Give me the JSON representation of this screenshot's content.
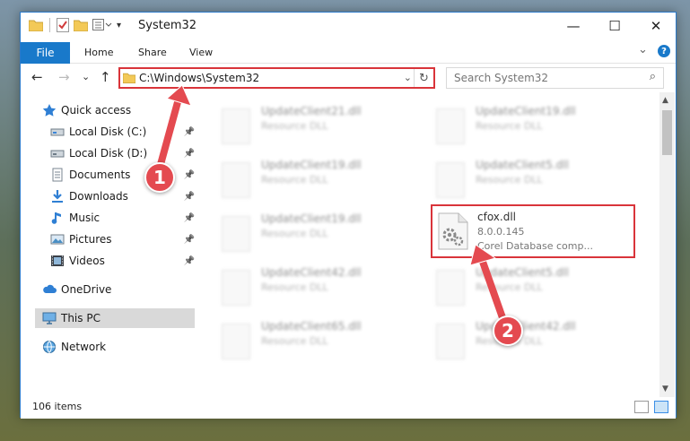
{
  "window": {
    "title": "System32",
    "minimize": "—",
    "maximize": "☐",
    "close": "✕"
  },
  "ribbon": {
    "tabs": [
      "File",
      "Home",
      "Share",
      "View"
    ],
    "expand": "⌄",
    "help": "?"
  },
  "navigation": {
    "back": "←",
    "forward": "→",
    "recent": "⌄",
    "up": "↑",
    "address": "C:\\Windows\\System32",
    "address_dropdown": "⌄",
    "refresh": "↻",
    "search_placeholder": "Search System32",
    "search_icon": "⌕"
  },
  "sidebar": {
    "items": [
      {
        "label": "Quick access",
        "icon": "star-icon",
        "pinned": false
      },
      {
        "label": "Local Disk (C:)",
        "icon": "drive-icon",
        "pinned": true
      },
      {
        "label": "Local Disk (D:)",
        "icon": "drive-icon",
        "pinned": true
      },
      {
        "label": "Documents",
        "icon": "documents-icon",
        "pinned": true
      },
      {
        "label": "Downloads",
        "icon": "downloads-icon",
        "pinned": true
      },
      {
        "label": "Music",
        "icon": "music-icon",
        "pinned": true
      },
      {
        "label": "Pictures",
        "icon": "pictures-icon",
        "pinned": true
      },
      {
        "label": "Videos",
        "icon": "videos-icon",
        "pinned": true
      },
      {
        "label": "OneDrive",
        "icon": "cloud-icon",
        "pinned": false
      },
      {
        "label": "This PC",
        "icon": "computer-icon",
        "pinned": false,
        "selected": true
      },
      {
        "label": "Network",
        "icon": "network-icon",
        "pinned": false
      }
    ],
    "pin_glyph": "📌"
  },
  "files": [
    {
      "name": "UpdateClient21.dll",
      "type": "Resource DLL"
    },
    {
      "name": "UpdateClient19.dll",
      "type": "Resource DLL"
    },
    {
      "name": "UpdateClient19.dll",
      "type": "Resource DLL"
    },
    {
      "name": "UpdateClient5.dll",
      "type": "Resource DLL"
    },
    {
      "name": "UpdateClient19.dll",
      "type": "Resource DLL"
    },
    {
      "name": "cfox.dll",
      "version": "8.0.0.145",
      "company": "Corel Database comp..."
    },
    {
      "name": "UpdateClient42.dll",
      "type": "Resource DLL"
    },
    {
      "name": "UpdateClient5.dll",
      "type": "Resource DLL"
    },
    {
      "name": "UpdateClient65.dll",
      "type": "Resource DLL"
    },
    {
      "name": "UpdateClient42.dll",
      "type": "Resource DLL"
    }
  ],
  "status": {
    "item_count": "106 items"
  },
  "annotations": {
    "badge1": "1",
    "badge2": "2",
    "color": "#e44a50"
  }
}
